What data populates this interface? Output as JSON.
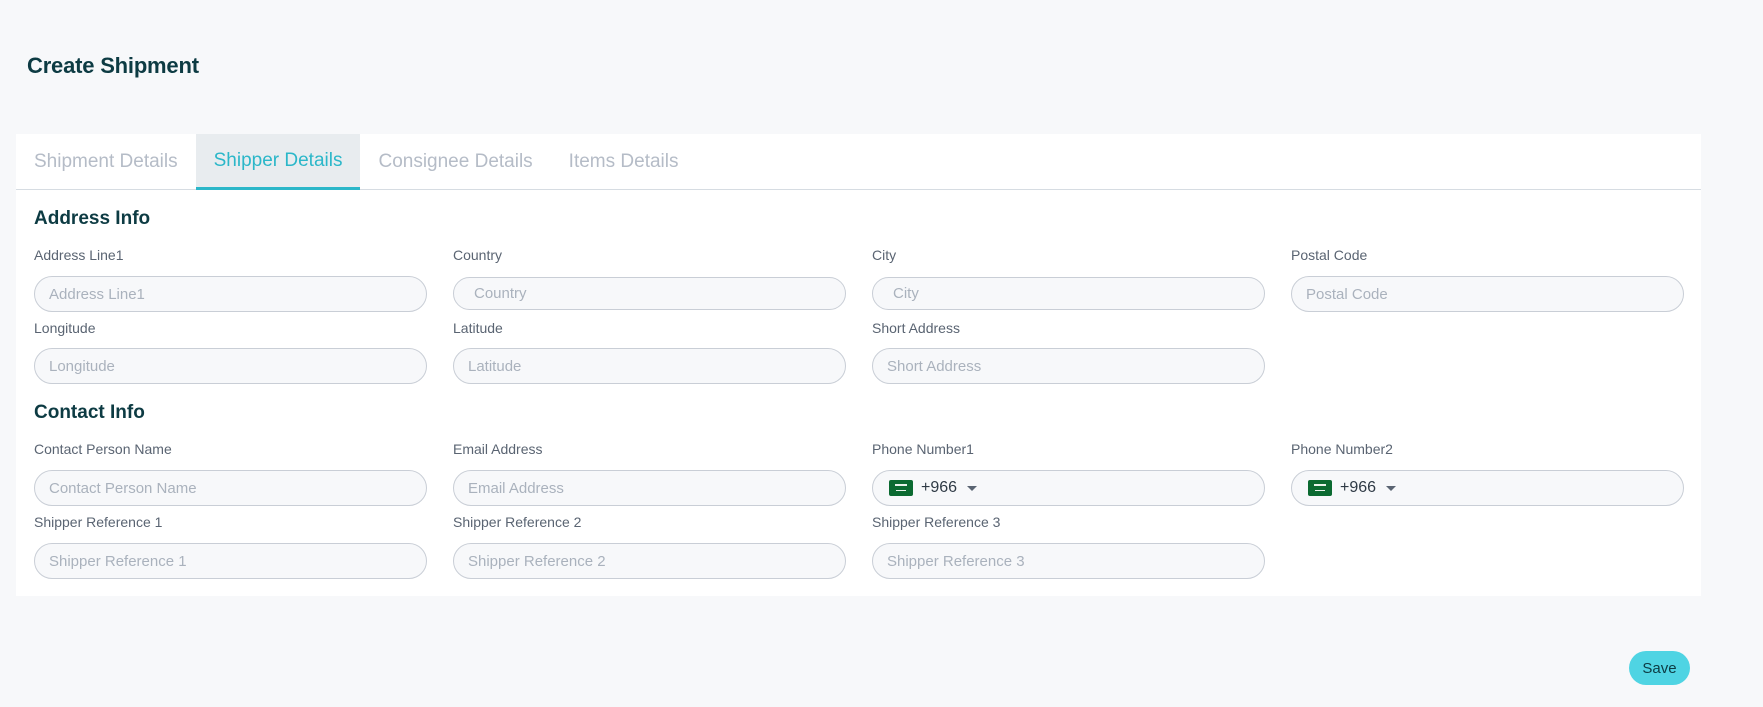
{
  "page": {
    "title": "Create Shipment"
  },
  "tabs": [
    {
      "label": "Shipment Details"
    },
    {
      "label": "Shipper Details"
    },
    {
      "label": "Consignee Details"
    },
    {
      "label": "Items Details"
    }
  ],
  "active_tab": "Shipper Details",
  "address_info": {
    "title": "Address Info",
    "address_line1": {
      "label": "Address Line1",
      "placeholder": "Address Line1"
    },
    "country": {
      "label": "Country",
      "placeholder": "Country"
    },
    "city": {
      "label": "City",
      "placeholder": "City"
    },
    "postal_code": {
      "label": "Postal Code",
      "placeholder": "Postal Code"
    },
    "longitude": {
      "label": "Longitude",
      "placeholder": "Longitude"
    },
    "latitude": {
      "label": "Latitude",
      "placeholder": "Latitude"
    },
    "short_address": {
      "label": "Short Address",
      "placeholder": "Short Address"
    }
  },
  "contact_info": {
    "title": "Contact Info",
    "contact_person_name": {
      "label": "Contact Person Name",
      "placeholder": "Contact Person Name"
    },
    "email_address": {
      "label": "Email Address",
      "placeholder": "Email Address"
    },
    "phone_number1": {
      "label": "Phone Number1",
      "dial_code": "+966",
      "flag_icon": "saudi-arabia-flag-icon"
    },
    "phone_number2": {
      "label": "Phone Number2",
      "dial_code": "+966",
      "flag_icon": "saudi-arabia-flag-icon"
    },
    "shipper_reference_1": {
      "label": "Shipper Reference 1",
      "placeholder": "Shipper Reference 1"
    },
    "shipper_reference_2": {
      "label": "Shipper Reference 2",
      "placeholder": "Shipper Reference 2"
    },
    "shipper_reference_3": {
      "label": "Shipper Reference 3",
      "placeholder": "Shipper Reference 3"
    }
  },
  "actions": {
    "save_label": "Save"
  },
  "colors": {
    "accent": "#2bb7c9",
    "save_button": "#4fd4e3",
    "heading": "#0d3b43",
    "tab_inactive": "#b5bcc7"
  }
}
